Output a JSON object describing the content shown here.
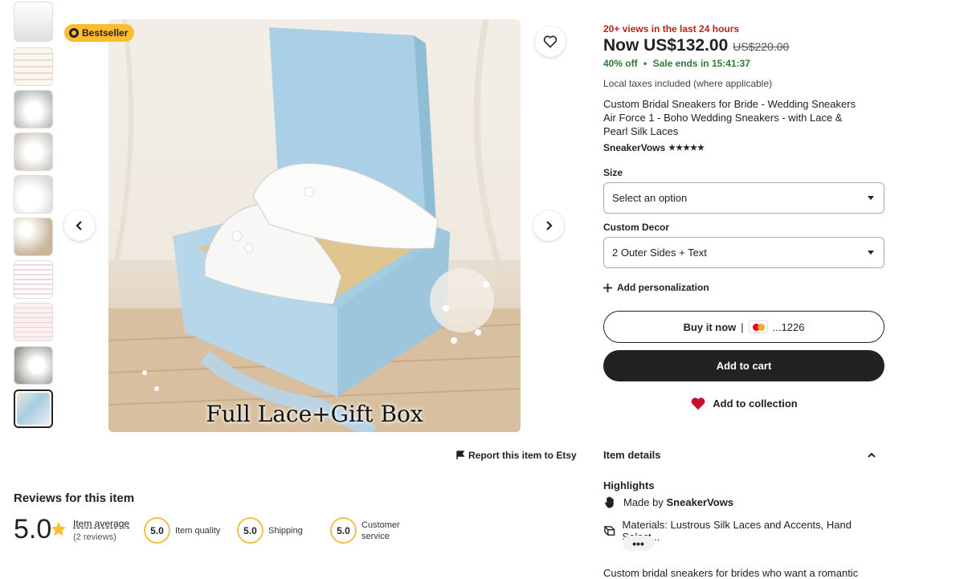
{
  "gallery": {
    "badge": "Bestseller",
    "caption": "Full Lace+Gift Box",
    "thumbnails": [
      {
        "color": "#e9e9e9"
      },
      {
        "color": "#f3efea"
      },
      {
        "color": "#dcdcdc"
      },
      {
        "color": "#e6e3de"
      },
      {
        "color": "#ebebeb"
      },
      {
        "color": "#d9c9b3"
      },
      {
        "color": "#f1e6e6"
      },
      {
        "color": "#f3e8e8"
      },
      {
        "color": "#cfcfcc"
      },
      {
        "color": "#bfd7e5"
      }
    ],
    "report_label": "Report this item to Etsy"
  },
  "listing": {
    "views": "20+ views in the last 24 hours",
    "price_now": "Now US$132.00",
    "price_old": "US$220.00",
    "discount": "40% off",
    "sale_ends": "Sale ends in 15:41:37",
    "taxes": "Local taxes included (where applicable)",
    "title": "Custom Bridal Sneakers for Bride - Wedding Sneakers Air Force 1 - Boho Wedding Sneakers - with Lace & Pearl Silk Laces",
    "shop": "SneakerVows",
    "rating_stars": "★★★★★"
  },
  "options": {
    "size_label": "Size",
    "size_value": "Select an option",
    "decor_label": "Custom Decor",
    "decor_value": "2 Outer Sides + Text",
    "add_personalization": "Add personalization"
  },
  "actions": {
    "buy_now": "Buy it now",
    "separator": "|",
    "card_last4": "...1226",
    "add_to_cart": "Add to cart",
    "add_to_collection": "Add to collection"
  },
  "details": {
    "heading": "Item details",
    "highlights": "Highlights",
    "made_by_prefix": "Made by",
    "made_by_shop": "SneakerVows",
    "materials": "Materials: Lustrous Silk Laces and Accents, Hand Select...",
    "more": "•••",
    "description": "Custom bridal sneakers for brides who want a romantic"
  },
  "reviews": {
    "title": "Reviews for this item",
    "average": "5.0",
    "average_label": "Item average",
    "count": "(2 reviews)",
    "quality_score": "5.0",
    "quality_label": "Item quality",
    "shipping_score": "5.0",
    "shipping_label": "Shipping",
    "service_score": "5.0",
    "service_label_1": "Customer",
    "service_label_2": "service"
  },
  "colors": {
    "accent_red": "#b3261e",
    "sale_green": "#2c7a3a",
    "badge_yellow": "#fdbd2f",
    "dark_button": "#222222",
    "heart_red": "#c8102e"
  }
}
